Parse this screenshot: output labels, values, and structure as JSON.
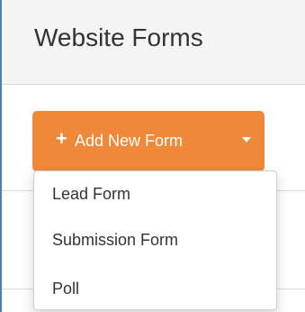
{
  "header": {
    "title": "Website Forms"
  },
  "add_button": {
    "icon": "plus-icon",
    "label": "Add New Form",
    "caret_icon": "caret-down-icon",
    "color": "#f0883a"
  },
  "dropdown": {
    "items": [
      {
        "label": "Lead Form"
      },
      {
        "label": "Submission Form"
      },
      {
        "label": "Poll"
      }
    ]
  }
}
